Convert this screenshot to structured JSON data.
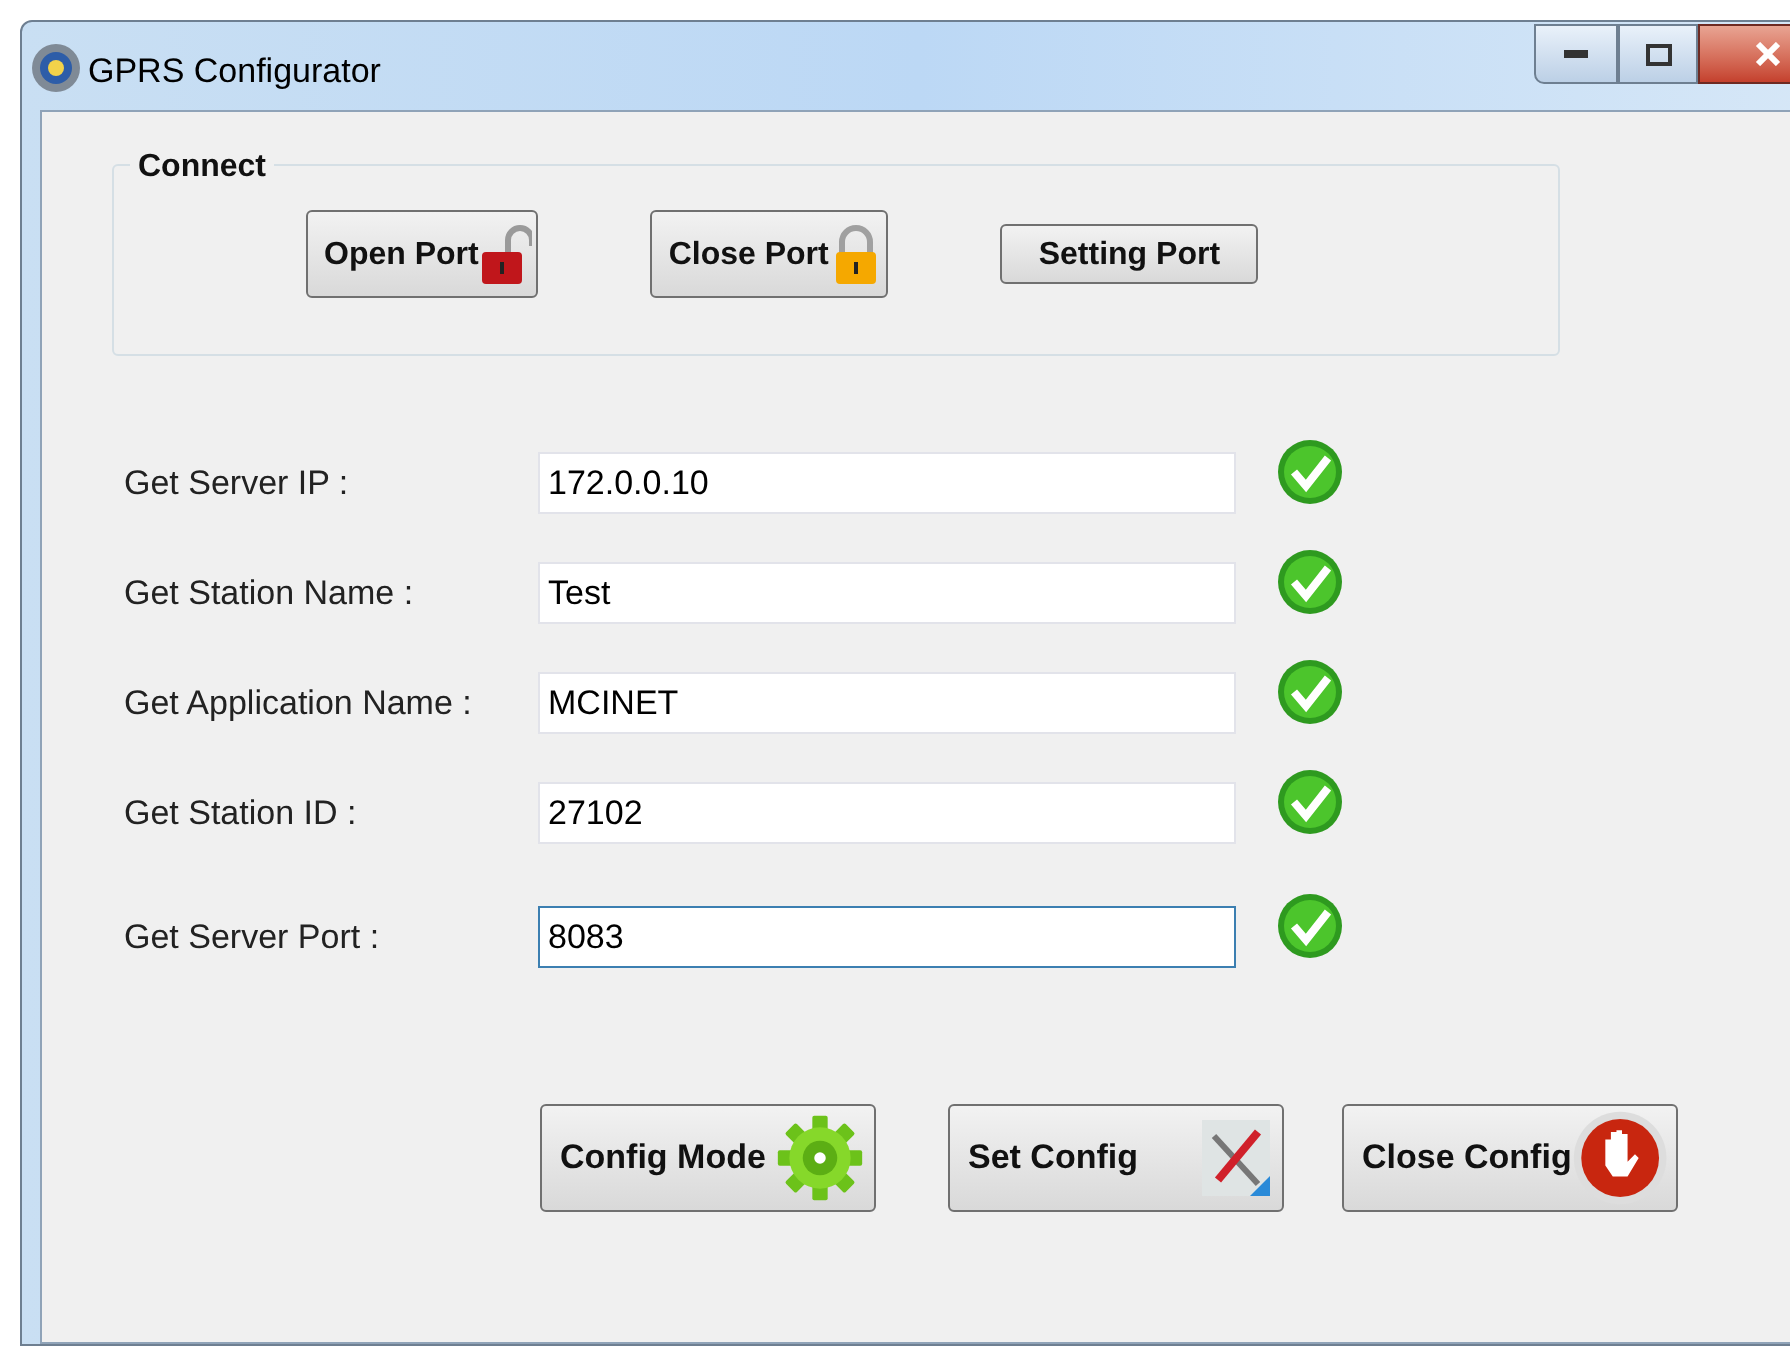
{
  "window": {
    "title": "GPRS Configurator"
  },
  "connect": {
    "title": "Connect",
    "buttons": [
      {
        "label": "Open Port",
        "kind": "unlock"
      },
      {
        "label": "Close Port",
        "kind": "lock"
      },
      {
        "label": "Setting Port",
        "kind": "plain"
      }
    ]
  },
  "fields": [
    {
      "label": "Get Server IP :",
      "value": "172.0.0.10",
      "focused": false,
      "ok": true
    },
    {
      "label": "Get Station Name :",
      "value": "Test",
      "focused": false,
      "ok": true
    },
    {
      "label": "Get Application Name :",
      "value": "MCINET",
      "focused": false,
      "ok": true
    },
    {
      "label": "Get Station ID :",
      "value": "27102",
      "focused": false,
      "ok": true
    },
    {
      "label": "Get Server Port :",
      "value": "8083",
      "focused": true,
      "ok": true
    }
  ],
  "actions": [
    {
      "label": "Config Mode",
      "kind": "gear"
    },
    {
      "label": "Set Config",
      "kind": "tools"
    },
    {
      "label": "Close Config",
      "kind": "stop"
    }
  ]
}
